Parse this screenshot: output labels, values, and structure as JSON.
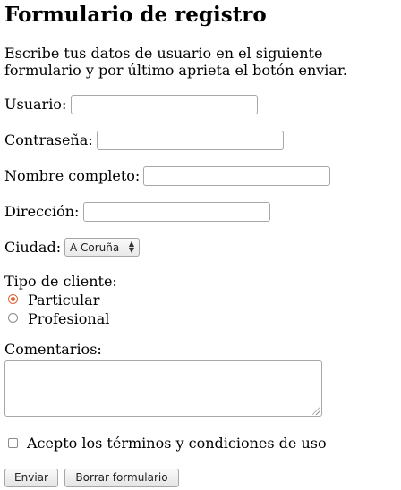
{
  "form": {
    "title": "Formulario de registro",
    "intro": "Escribe tus datos de usuario en el siguiente formulario y por último aprieta el botón enviar.",
    "fields": {
      "usuario_label": "Usuario:",
      "usuario_value": "",
      "contrasena_label": "Contraseña:",
      "contrasena_value": "",
      "nombre_label": "Nombre completo:",
      "nombre_value": "",
      "direccion_label": "Dirección:",
      "direccion_value": "",
      "ciudad_label": "Ciudad:",
      "ciudad_selected": "A Coruña",
      "tipo_label": "Tipo de cliente:",
      "tipo_options": [
        "Particular",
        "Profesional"
      ],
      "tipo_selected": "Particular",
      "comentarios_label": "Comentarios:",
      "comentarios_value": "",
      "terminos_label": "Acepto los términos y condiciones de uso",
      "terminos_checked": false
    },
    "buttons": {
      "submit_label": "Enviar",
      "reset_label": "Borrar formulario"
    }
  }
}
